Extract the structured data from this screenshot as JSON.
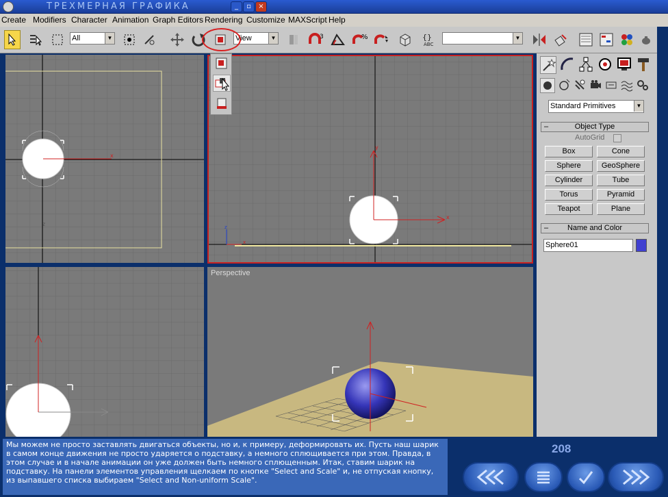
{
  "window": {
    "title": "ТРЕХМЕРНАЯ ГРАФИКА"
  },
  "menu": [
    "Create",
    "Modifiers",
    "Character",
    "Animation",
    "Graph Editors",
    "Rendering",
    "Customize",
    "MAXScript",
    "Help"
  ],
  "toolbar": {
    "selection_filter": "All",
    "ref_coord": "View",
    "named_selection": ""
  },
  "viewports": {
    "perspective_label": "Perspective"
  },
  "command_panel": {
    "category_dropdown": "Standard Primitives",
    "object_type": {
      "header": "Object Type",
      "autogrid_label": "AutoGrid",
      "buttons": [
        "Box",
        "Cone",
        "Sphere",
        "GeoSphere",
        "Cylinder",
        "Tube",
        "Torus",
        "Pyramid",
        "Teapot",
        "Plane"
      ]
    },
    "name_color": {
      "header": "Name and Color",
      "name_value": "Sphere01",
      "color": "#4040d0"
    }
  },
  "lesson": {
    "caption": "Мы можем не просто заставлять двигаться объекты, но и, к примеру, деформировать их. Пусть наш шарик в самом конце движения не просто ударяется о подставку, а немного сплющивается при этом. Правда, в этом случае и в начале анимации он уже должен быть немного сплющенным. Итак, ставим шарик на подставку. На панели элементов управления щелкаем по кнопке \"Select and Scale\" и, не отпуская кнопку, из выпавшего списка выбираем \"Select and Non-uniform Scale\".",
    "page_number": "208"
  },
  "colors": {
    "accent": "#d82020",
    "caption_bg": "#3a68b8",
    "viewport_bg": "#7a7a7a"
  }
}
